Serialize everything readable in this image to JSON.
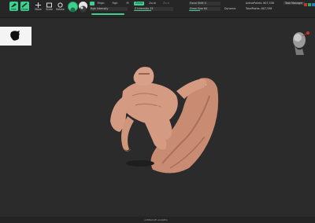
{
  "toolbar": {
    "buttons": [
      {
        "name": "edit-button",
        "label": "Edit",
        "icon": "edit-icon",
        "active": true
      },
      {
        "name": "draw-button",
        "label": "Draw",
        "icon": "draw-icon",
        "active": true
      },
      {
        "name": "move-button",
        "label": "Move",
        "icon": "move-icon",
        "active": false
      },
      {
        "name": "scale-button",
        "label": "Scale",
        "icon": "scale-icon",
        "active": false
      },
      {
        "name": "rotate-button",
        "label": "Rotate",
        "icon": "rotate-icon",
        "active": false
      }
    ],
    "modes": {
      "rgb": "Rgb",
      "mrgb": "Mrgb",
      "m": "M",
      "zadd": "Zadd",
      "zsub": "Zsub",
      "zcut": "Zcut"
    },
    "sliders": {
      "rgb_intensity": "Rgb Intensity",
      "z_intensity": "Z Intensity 25",
      "focal_shift": "Focal Shift 0",
      "draw_size": "Draw Size 64",
      "dynamic": "Dynamic"
    },
    "stats": {
      "active_points": "ActivePoints: 807,558",
      "total_points": "TotalPoints: 807,558"
    },
    "tooltip": "Task Manager"
  },
  "footer": {
    "text": "untitled.ztl   sculptris"
  },
  "colors": {
    "accent": "#3fcf8e",
    "background": "#2b2b2b",
    "toolbar": "#262626",
    "model": "#d59a82"
  }
}
